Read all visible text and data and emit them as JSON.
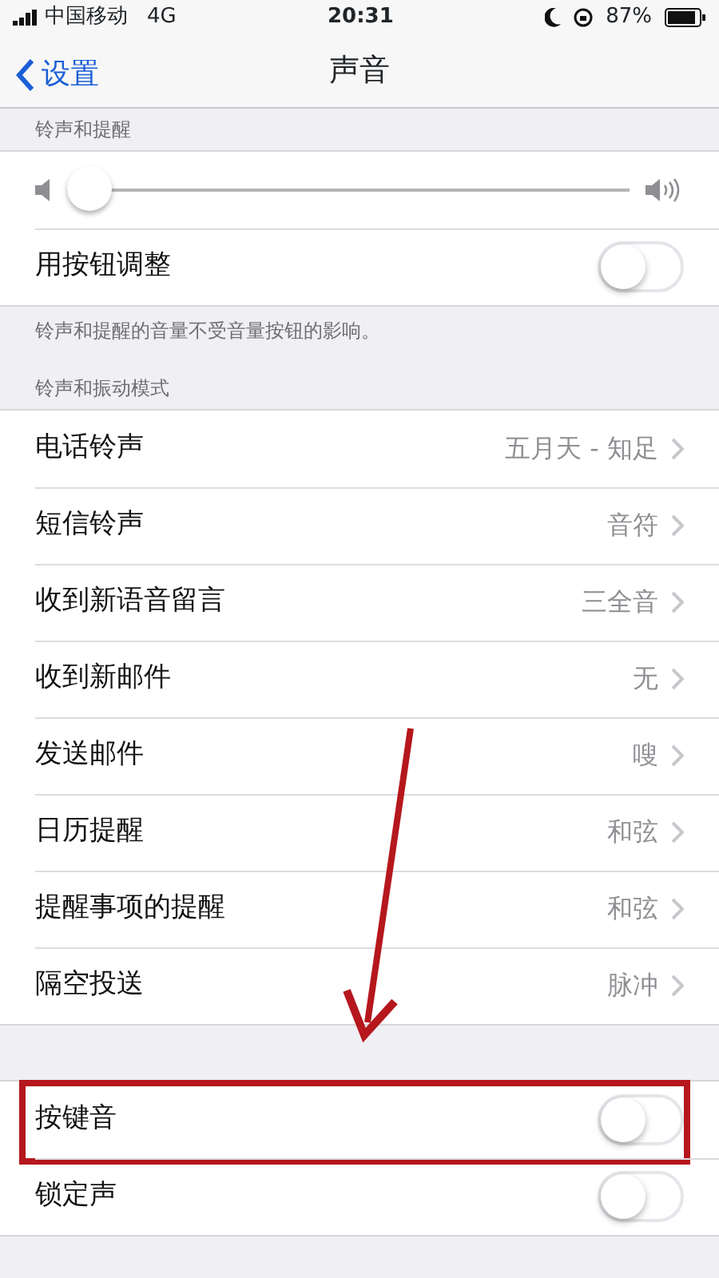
{
  "status_bar": {
    "carrier": "中国移动",
    "network": "4G",
    "time": "20:31",
    "battery": "87%"
  },
  "nav": {
    "back": "设置",
    "title": "声音"
  },
  "sections": [
    {
      "header": "铃声和提醒",
      "rows": [
        {
          "kind": "slider",
          "level": 0.0
        },
        {
          "kind": "toggle",
          "label": "用按钮调整",
          "on": false,
          "highlighted": false
        }
      ],
      "footer": "铃声和提醒的音量不受音量按钮的影响。"
    },
    {
      "header": "铃声和振动模式",
      "rows": [
        {
          "kind": "link",
          "label": "电话铃声",
          "value": "五月天 - 知足"
        },
        {
          "kind": "link",
          "label": "短信铃声",
          "value": "音符"
        },
        {
          "kind": "link",
          "label": "收到新语音留言",
          "value": "三全音"
        },
        {
          "kind": "link",
          "label": "收到新邮件",
          "value": "无"
        },
        {
          "kind": "link",
          "label": "发送邮件",
          "value": "嗖"
        },
        {
          "kind": "link",
          "label": "日历提醒",
          "value": "和弦"
        },
        {
          "kind": "link",
          "label": "提醒事项的提醒",
          "value": "和弦"
        },
        {
          "kind": "link",
          "label": "隔空投送",
          "value": "脉冲"
        }
      ]
    },
    {
      "rows": [
        {
          "kind": "toggle",
          "label": "按键音",
          "on": false,
          "highlighted": true
        },
        {
          "kind": "toggle",
          "label": "锁定声",
          "on": false,
          "highlighted": false
        }
      ]
    }
  ]
}
